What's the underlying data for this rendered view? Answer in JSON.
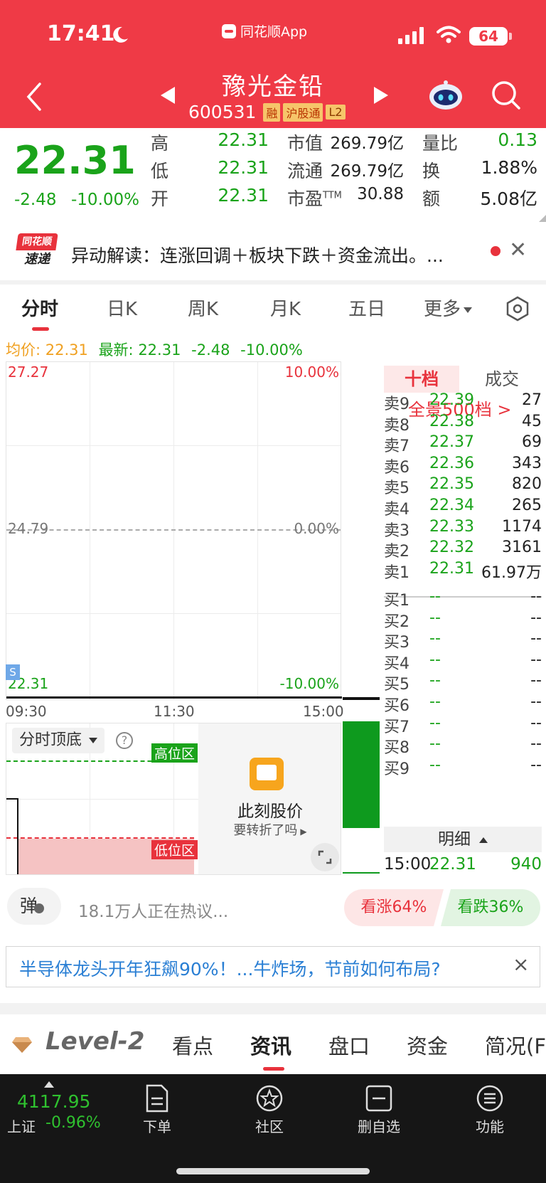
{
  "status": {
    "time": "17:41",
    "app_name": "同花顺App",
    "battery": "64"
  },
  "stock": {
    "name": "豫光金铅",
    "code": "600531",
    "tags": [
      "融",
      "沪股通",
      "L2"
    ]
  },
  "quote": {
    "price": "22.31",
    "change": "-2.48",
    "change_pct": "-10.00%",
    "high_label": "高",
    "high": "22.31",
    "low_label": "低",
    "low": "22.31",
    "open_label": "开",
    "open": "22.31",
    "mktcap_label": "市值",
    "mktcap": "269.79亿",
    "float_label": "流通",
    "float": "269.79亿",
    "pe_label": "市盈",
    "pe_suffix": "TTM",
    "pe": "30.88",
    "vr_label": "量比",
    "vr": "0.13",
    "turnover_label": "换",
    "turnover": "1.88%",
    "amount_label": "额",
    "amount": "5.08亿"
  },
  "alert": {
    "logo_top": "同花顺",
    "logo_bottom": "速递",
    "text": "异动解读：连涨回调＋板块下跌＋资金流出。..."
  },
  "chart_tabs": [
    "分时",
    "日K",
    "周K",
    "月K",
    "五日",
    "更多"
  ],
  "chart_header": {
    "avg": "均价: 22.31",
    "latest": "最新: 22.31",
    "chg": "-2.48",
    "pct": "-10.00%"
  },
  "chart_axis": {
    "top_price": "27.27",
    "top_pct": "10.00%",
    "mid_price": "24.79",
    "mid_pct": "0.00%",
    "bot_price": "22.31",
    "bot_pct": "-10.00%",
    "times": [
      "09:30",
      "11:30",
      "15:00"
    ],
    "s_marker": "S"
  },
  "indicator": {
    "name": "分时顶底",
    "help": "?",
    "high_zone": "高位区",
    "low_zone": "低位区",
    "ad_title": "此刻股价",
    "ad_sub": "要转折了吗"
  },
  "order_book": {
    "tab_a": "十档",
    "tab_b": "成交",
    "full": "全景500档 >",
    "sells": [
      {
        "label": "卖9",
        "price": "22.39",
        "vol": "27"
      },
      {
        "label": "卖8",
        "price": "22.38",
        "vol": "45"
      },
      {
        "label": "卖7",
        "price": "22.37",
        "vol": "69"
      },
      {
        "label": "卖6",
        "price": "22.36",
        "vol": "343"
      },
      {
        "label": "卖5",
        "price": "22.35",
        "vol": "820"
      },
      {
        "label": "卖4",
        "price": "22.34",
        "vol": "265"
      },
      {
        "label": "卖3",
        "price": "22.33",
        "vol": "1174"
      },
      {
        "label": "卖2",
        "price": "22.32",
        "vol": "3161"
      },
      {
        "label": "卖1",
        "price": "22.31",
        "vol": "61.97万"
      }
    ],
    "buys": [
      {
        "label": "买1",
        "price": "--",
        "vol": "--"
      },
      {
        "label": "买2",
        "price": "--",
        "vol": "--"
      },
      {
        "label": "买3",
        "price": "--",
        "vol": "--"
      },
      {
        "label": "买4",
        "price": "--",
        "vol": "--"
      },
      {
        "label": "买5",
        "price": "--",
        "vol": "--"
      },
      {
        "label": "买6",
        "price": "--",
        "vol": "--"
      },
      {
        "label": "买7",
        "price": "--",
        "vol": "--"
      },
      {
        "label": "买8",
        "price": "--",
        "vol": "--"
      },
      {
        "label": "买9",
        "price": "--",
        "vol": "--"
      }
    ],
    "detail": "明细",
    "last_trade": {
      "time": "15:00",
      "price": "22.31",
      "vol": "940"
    }
  },
  "discussion": {
    "danmu": "弹",
    "text": "18.1万人正在热议...",
    "up": "看涨64%",
    "down": "看跌36%"
  },
  "headline": {
    "text": "半导体龙头开年狂飙90%！...牛炸场，节前如何布局?",
    "close": "×"
  },
  "section_tabs": {
    "brand": "Level-2",
    "items": [
      "看点",
      "资讯",
      "盘口",
      "资金",
      "简况(F"
    ]
  },
  "bottom_bar": {
    "index_value": "4117.95",
    "index_name": "上证",
    "index_change": "-0.96%",
    "items": [
      "下单",
      "社区",
      "删自选",
      "功能"
    ]
  },
  "colors": {
    "header_red": "#ef3a46",
    "down_green": "#1aa31a",
    "up_red": "#e8323c",
    "link_blue": "#2a7fd4"
  }
}
